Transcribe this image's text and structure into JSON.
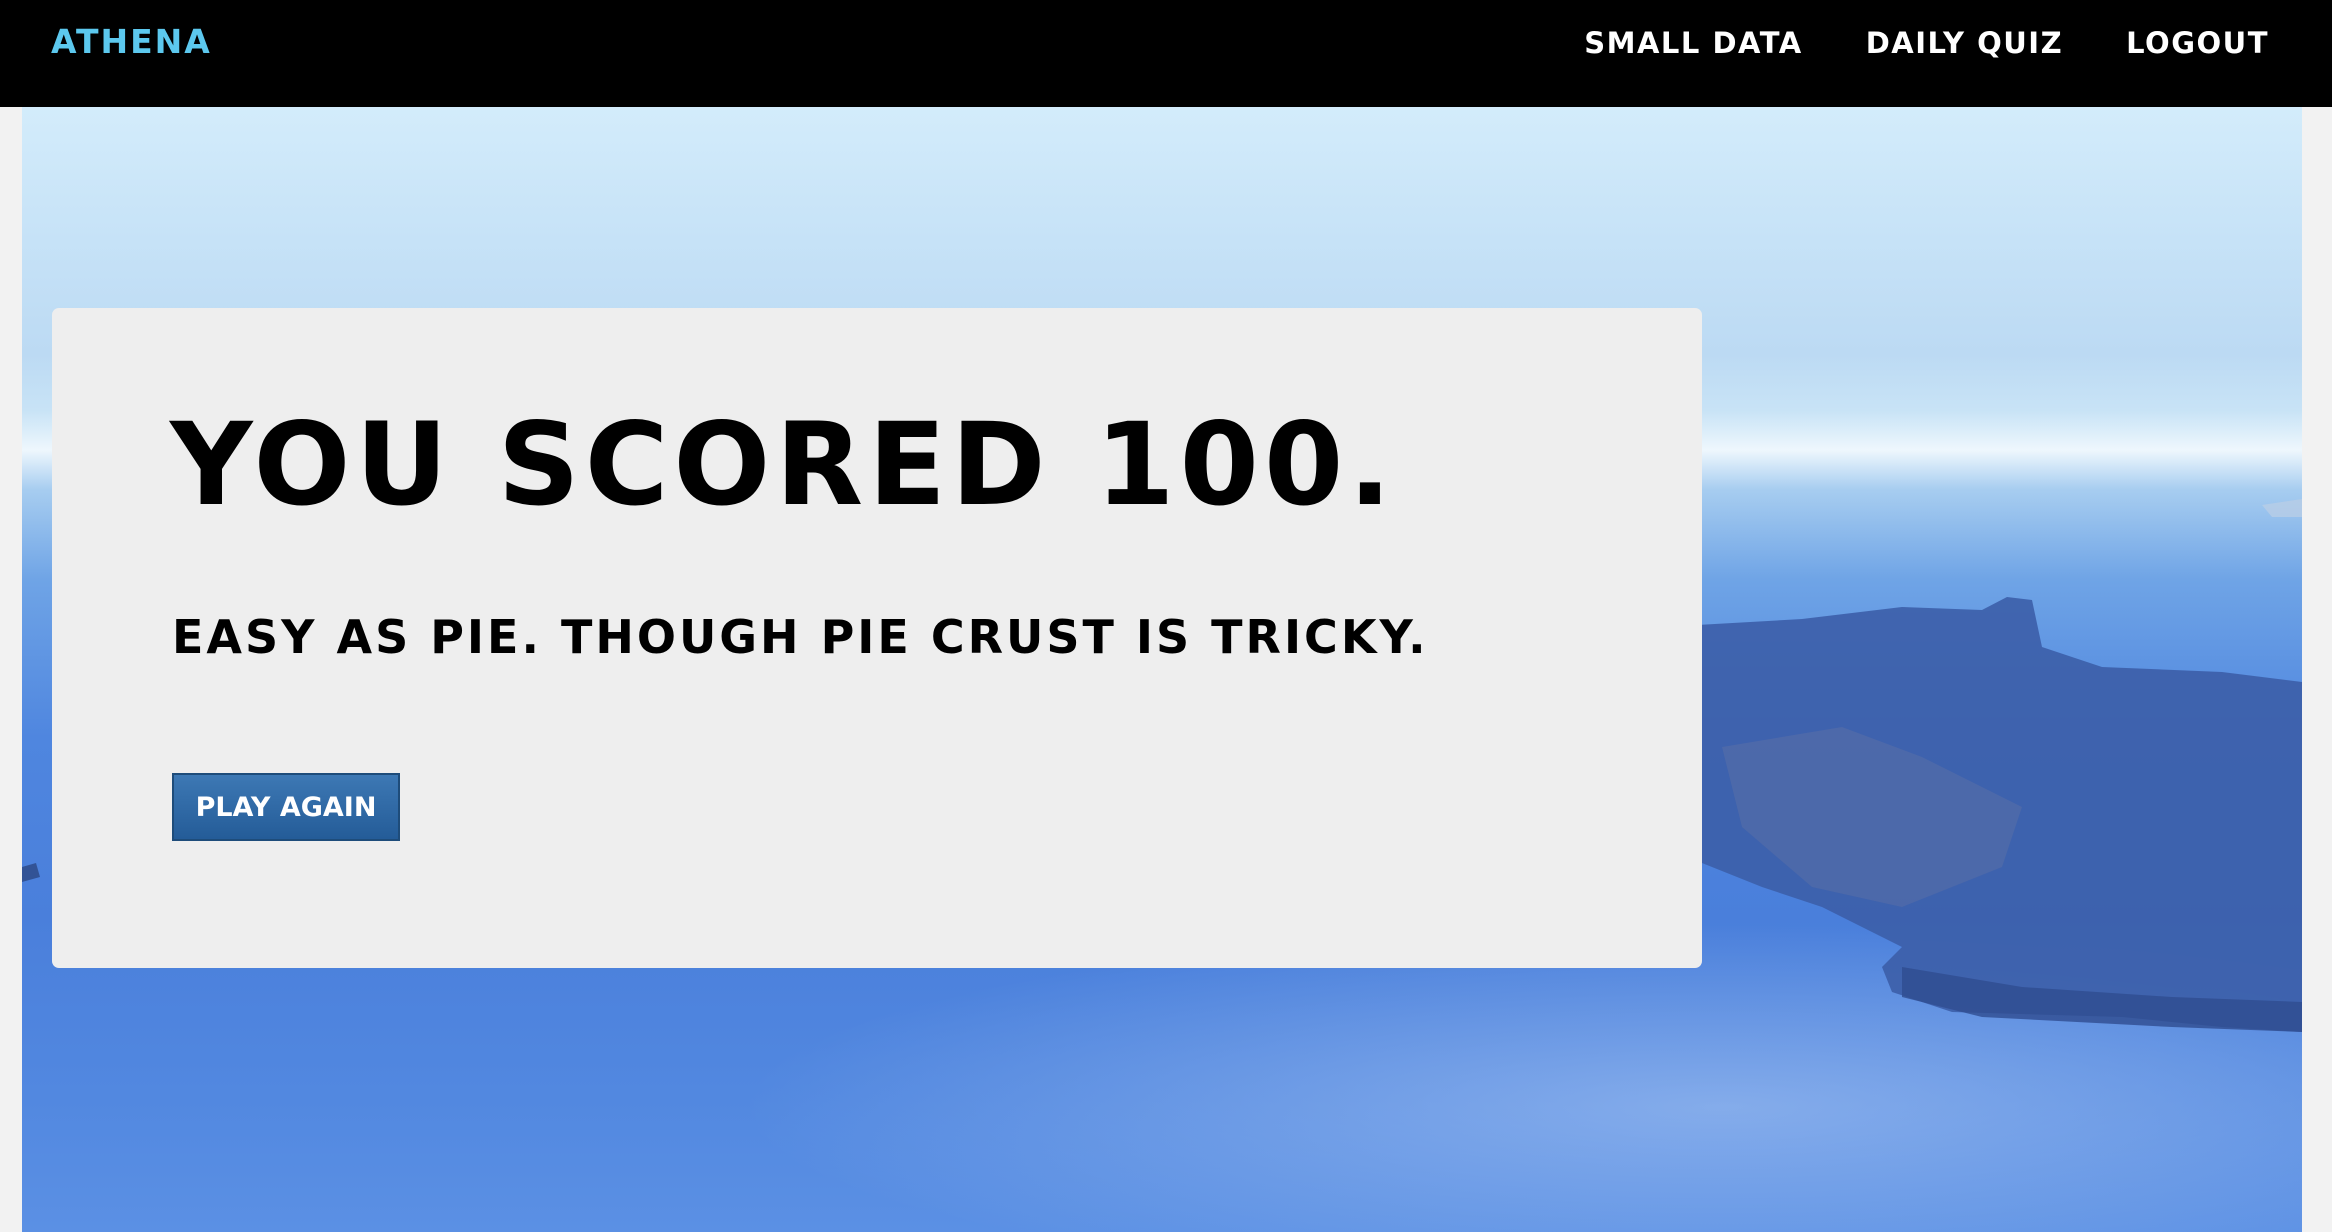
{
  "header": {
    "brand": "ATHENA",
    "nav": [
      {
        "label": "SMALL DATA"
      },
      {
        "label": "DAILY QUIZ"
      },
      {
        "label": "LOGOUT"
      }
    ]
  },
  "result": {
    "score_text": "YOU SCORED 100.",
    "message": "EASY AS PIE. THOUGH PIE CRUST IS TRICKY.",
    "play_again_label": "PLAY AGAIN"
  },
  "colors": {
    "navbar": "#000000",
    "brand": "#5cc8ee",
    "card": "#eeeeee",
    "button": "#2f6aa6"
  }
}
